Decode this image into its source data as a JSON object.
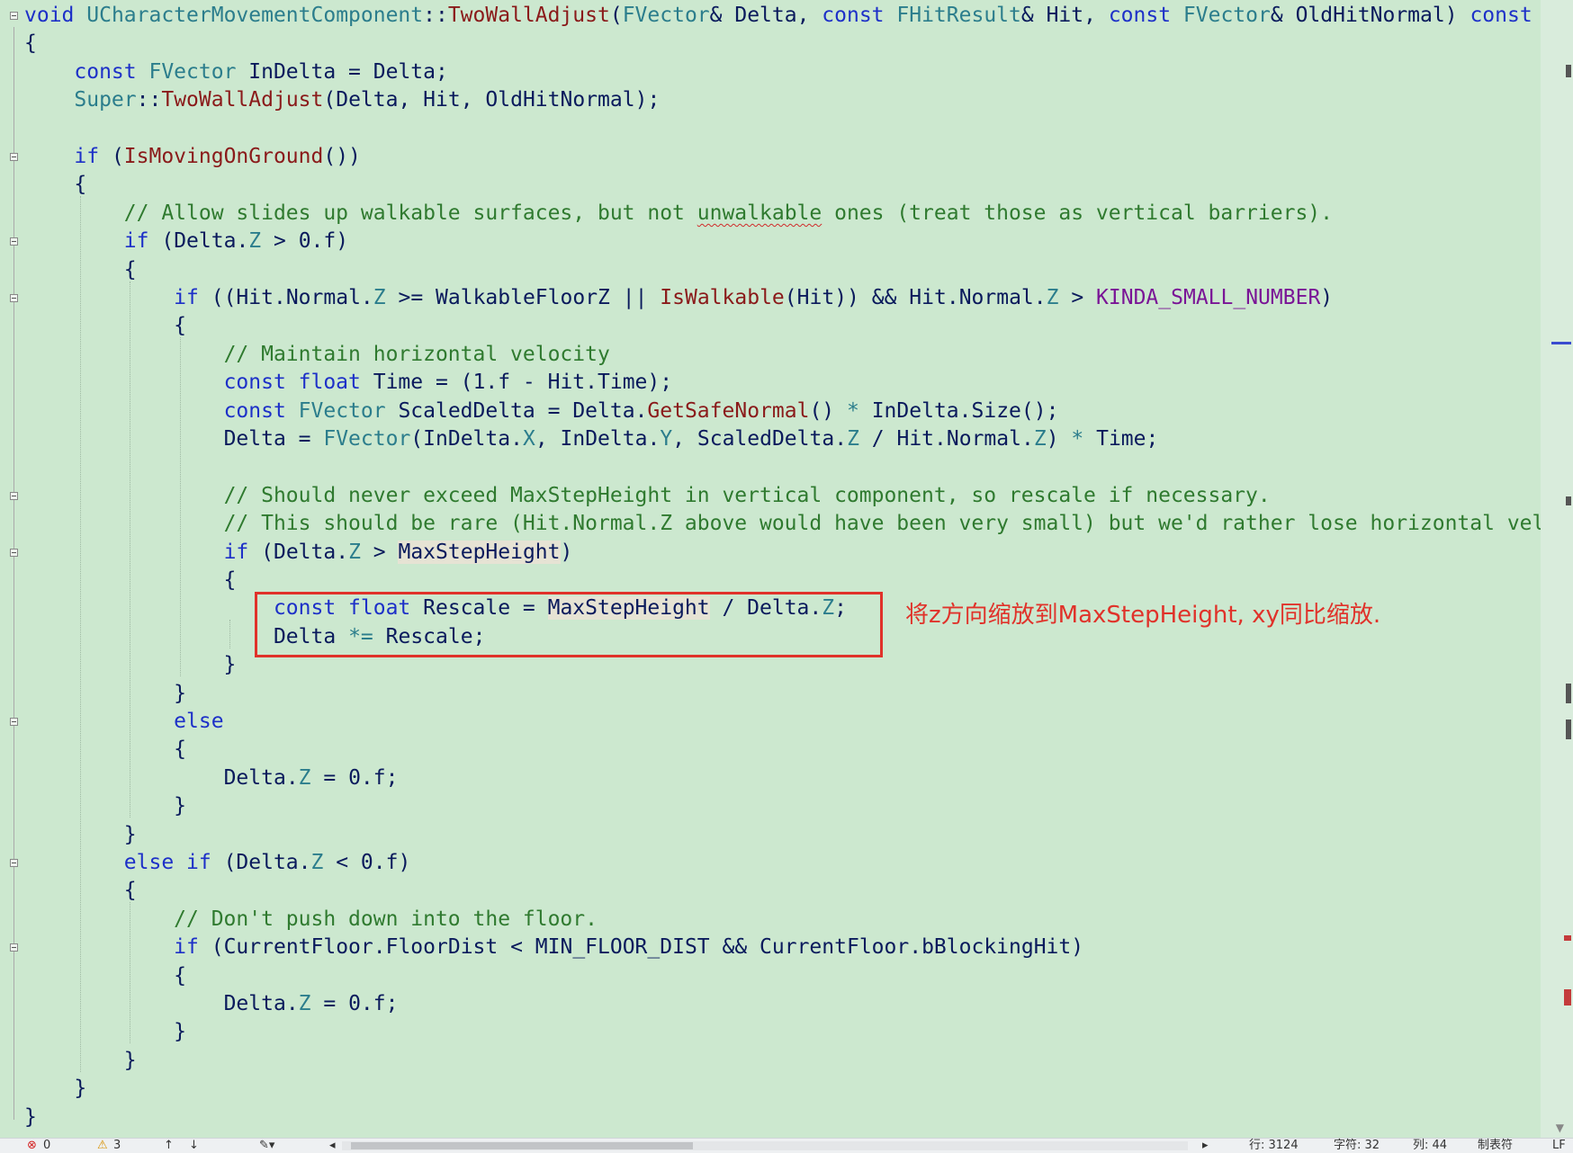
{
  "editor": {
    "lines": [
      [
        [
          "kw",
          "void "
        ],
        [
          "ty",
          "UCharacterMovementComponent"
        ],
        [
          "pu",
          "::"
        ],
        [
          "fn",
          "TwoWallAdjust"
        ],
        [
          "pu",
          "("
        ],
        [
          "ty",
          "FVector"
        ],
        [
          "pu",
          "& "
        ],
        [
          "va",
          "Delta"
        ],
        [
          "pu",
          ", "
        ],
        [
          "kw",
          "const "
        ],
        [
          "ty",
          "FHitResult"
        ],
        [
          "pu",
          "& "
        ],
        [
          "va",
          "Hit"
        ],
        [
          "pu",
          ", "
        ],
        [
          "kw",
          "const "
        ],
        [
          "ty",
          "FVector"
        ],
        [
          "pu",
          "& "
        ],
        [
          "va",
          "OldHitNormal"
        ],
        [
          "pu",
          ") "
        ],
        [
          "kw",
          "const"
        ]
      ],
      [
        [
          "pu",
          "{"
        ]
      ],
      [
        [
          "pu",
          "    "
        ],
        [
          "kw",
          "const "
        ],
        [
          "ty",
          "FVector "
        ],
        [
          "va",
          "InDelta"
        ],
        [
          "pu",
          " = "
        ],
        [
          "va",
          "Delta"
        ],
        [
          "pu",
          ";"
        ]
      ],
      [
        [
          "pu",
          "    "
        ],
        [
          "ty",
          "Super"
        ],
        [
          "pu",
          "::"
        ],
        [
          "fn",
          "TwoWallAdjust"
        ],
        [
          "pu",
          "("
        ],
        [
          "va",
          "Delta"
        ],
        [
          "pu",
          ", "
        ],
        [
          "va",
          "Hit"
        ],
        [
          "pu",
          ", "
        ],
        [
          "va",
          "OldHitNormal"
        ],
        [
          "pu",
          ");"
        ]
      ],
      [],
      [
        [
          "pu",
          "    "
        ],
        [
          "kw",
          "if "
        ],
        [
          "pu",
          "("
        ],
        [
          "fn",
          "IsMovingOnGround"
        ],
        [
          "pu",
          "())"
        ]
      ],
      [
        [
          "pu",
          "    {"
        ]
      ],
      [
        [
          "pu",
          "        "
        ],
        [
          "cm",
          "// Allow slides up walkable surfaces, but not "
        ],
        [
          "cm sq",
          "unwalkable"
        ],
        [
          "cm",
          " ones (treat those as vertical barriers)."
        ]
      ],
      [
        [
          "pu",
          "        "
        ],
        [
          "kw",
          "if "
        ],
        [
          "pu",
          "("
        ],
        [
          "va",
          "Delta"
        ],
        [
          "pu",
          "."
        ],
        [
          "ty",
          "Z"
        ],
        [
          "pu",
          " > 0.f)"
        ]
      ],
      [
        [
          "pu",
          "        {"
        ]
      ],
      [
        [
          "pu",
          "            "
        ],
        [
          "kw",
          "if "
        ],
        [
          "pu",
          "(("
        ],
        [
          "va",
          "Hit"
        ],
        [
          "pu",
          "."
        ],
        [
          "va",
          "Normal"
        ],
        [
          "pu",
          "."
        ],
        [
          "ty",
          "Z"
        ],
        [
          "pu",
          " >= "
        ],
        [
          "va",
          "WalkableFloorZ"
        ],
        [
          "pu",
          " || "
        ],
        [
          "fn",
          "IsWalkable"
        ],
        [
          "pu",
          "("
        ],
        [
          "va",
          "Hit"
        ],
        [
          "pu",
          ")) && "
        ],
        [
          "va",
          "Hit"
        ],
        [
          "pu",
          "."
        ],
        [
          "va",
          "Normal"
        ],
        [
          "pu",
          "."
        ],
        [
          "ty",
          "Z"
        ],
        [
          "pu",
          " > "
        ],
        [
          "mc",
          "KINDA_SMALL_NUMBER"
        ],
        [
          "pu",
          ")"
        ]
      ],
      [
        [
          "pu",
          "            {"
        ]
      ],
      [
        [
          "pu",
          "                "
        ],
        [
          "cm",
          "// Maintain horizontal velocity"
        ]
      ],
      [
        [
          "pu",
          "                "
        ],
        [
          "kw",
          "const float "
        ],
        [
          "va",
          "Time"
        ],
        [
          "pu",
          " = (1.f - "
        ],
        [
          "va",
          "Hit"
        ],
        [
          "pu",
          "."
        ],
        [
          "va",
          "Time"
        ],
        [
          "pu",
          ");"
        ]
      ],
      [
        [
          "pu",
          "                "
        ],
        [
          "kw",
          "const "
        ],
        [
          "ty",
          "FVector "
        ],
        [
          "va",
          "ScaledDelta"
        ],
        [
          "pu",
          " = "
        ],
        [
          "va",
          "Delta"
        ],
        [
          "pu",
          "."
        ],
        [
          "fn",
          "GetSafeNormal"
        ],
        [
          "pu",
          "() "
        ],
        [
          "ty",
          "*"
        ],
        [
          "pu",
          " "
        ],
        [
          "va",
          "InDelta"
        ],
        [
          "pu",
          "."
        ],
        [
          "va",
          "Size"
        ],
        [
          "pu",
          "();"
        ]
      ],
      [
        [
          "pu",
          "                "
        ],
        [
          "va",
          "Delta"
        ],
        [
          "pu",
          " = "
        ],
        [
          "ty",
          "FVector"
        ],
        [
          "pu",
          "("
        ],
        [
          "va",
          "InDelta"
        ],
        [
          "pu",
          "."
        ],
        [
          "ty",
          "X"
        ],
        [
          "pu",
          ", "
        ],
        [
          "va",
          "InDelta"
        ],
        [
          "pu",
          "."
        ],
        [
          "ty",
          "Y"
        ],
        [
          "pu",
          ", "
        ],
        [
          "va",
          "ScaledDelta"
        ],
        [
          "pu",
          "."
        ],
        [
          "ty",
          "Z"
        ],
        [
          "pu",
          " / "
        ],
        [
          "va",
          "Hit"
        ],
        [
          "pu",
          "."
        ],
        [
          "va",
          "Normal"
        ],
        [
          "pu",
          "."
        ],
        [
          "ty",
          "Z"
        ],
        [
          "pu",
          ") "
        ],
        [
          "ty",
          "*"
        ],
        [
          "pu",
          " "
        ],
        [
          "va",
          "Time"
        ],
        [
          "pu",
          ";"
        ]
      ],
      [],
      [
        [
          "pu",
          "                "
        ],
        [
          "cm",
          "// Should never exceed MaxStepHeight in vertical component, so rescale if necessary."
        ]
      ],
      [
        [
          "pu",
          "                "
        ],
        [
          "cm",
          "// This should be rare (Hit.Normal.Z above would have been very small) but we'd rather lose horizontal vel"
        ]
      ],
      [
        [
          "pu",
          "                "
        ],
        [
          "kw",
          "if "
        ],
        [
          "pu",
          "("
        ],
        [
          "va",
          "Delta"
        ],
        [
          "pu",
          "."
        ],
        [
          "ty",
          "Z"
        ],
        [
          "pu",
          " > "
        ],
        [
          "va hl",
          "MaxStepHeight"
        ],
        [
          "pu",
          ")"
        ]
      ],
      [
        [
          "pu",
          "                {"
        ]
      ],
      [
        [
          "pu",
          "                    "
        ],
        [
          "kw",
          "const float "
        ],
        [
          "va",
          "Rescale"
        ],
        [
          "pu",
          " = "
        ],
        [
          "va hl",
          "MaxStepHeight"
        ],
        [
          "pu",
          " / "
        ],
        [
          "va",
          "Delta"
        ],
        [
          "pu",
          "."
        ],
        [
          "ty",
          "Z"
        ],
        [
          "pu",
          ";"
        ]
      ],
      [
        [
          "pu",
          "                    "
        ],
        [
          "va",
          "Delta"
        ],
        [
          "pu",
          " "
        ],
        [
          "ty",
          "*="
        ],
        [
          "pu",
          " "
        ],
        [
          "va",
          "Rescale"
        ],
        [
          "pu",
          ";"
        ]
      ],
      [
        [
          "pu",
          "                }"
        ]
      ],
      [
        [
          "pu",
          "            }"
        ]
      ],
      [
        [
          "pu",
          "            "
        ],
        [
          "kw",
          "else"
        ]
      ],
      [
        [
          "pu",
          "            {"
        ]
      ],
      [
        [
          "pu",
          "                "
        ],
        [
          "va",
          "Delta"
        ],
        [
          "pu",
          "."
        ],
        [
          "ty",
          "Z"
        ],
        [
          "pu",
          " = 0.f;"
        ]
      ],
      [
        [
          "pu",
          "            }"
        ]
      ],
      [
        [
          "pu",
          "        }"
        ]
      ],
      [
        [
          "pu",
          "        "
        ],
        [
          "kw",
          "else if "
        ],
        [
          "pu",
          "("
        ],
        [
          "va",
          "Delta"
        ],
        [
          "pu",
          "."
        ],
        [
          "ty",
          "Z"
        ],
        [
          "pu",
          " < 0.f)"
        ]
      ],
      [
        [
          "pu",
          "        {"
        ]
      ],
      [
        [
          "pu",
          "            "
        ],
        [
          "cm",
          "// Don't push down into the floor."
        ]
      ],
      [
        [
          "pu",
          "            "
        ],
        [
          "kw",
          "if "
        ],
        [
          "pu",
          "("
        ],
        [
          "va",
          "CurrentFloor"
        ],
        [
          "pu",
          "."
        ],
        [
          "va",
          "FloorDist"
        ],
        [
          "pu",
          " < "
        ],
        [
          "va",
          "MIN_FLOOR_DIST"
        ],
        [
          "pu",
          " && "
        ],
        [
          "va",
          "CurrentFloor"
        ],
        [
          "pu",
          "."
        ],
        [
          "va",
          "bBlockingHit"
        ],
        [
          "pu",
          ")"
        ]
      ],
      [
        [
          "pu",
          "            {"
        ]
      ],
      [
        [
          "pu",
          "                "
        ],
        [
          "va",
          "Delta"
        ],
        [
          "pu",
          "."
        ],
        [
          "ty",
          "Z"
        ],
        [
          "pu",
          " = 0.f;"
        ]
      ],
      [
        [
          "pu",
          "            }"
        ]
      ],
      [
        [
          "pu",
          "        }"
        ]
      ],
      [
        [
          "pu",
          "    }"
        ]
      ],
      [
        [
          "pu",
          "}"
        ]
      ]
    ],
    "fold_lines": [
      0,
      5,
      8,
      10,
      17,
      19,
      25,
      30,
      33
    ]
  },
  "annotation": {
    "text": "将z方向缩放到MaxStepHeight, xy同比缩放.",
    "color": "#e0322a"
  },
  "statusbar": {
    "errors": "0",
    "warnings": "3",
    "line": "行: 3124",
    "char": "字符: 32",
    "col": "列: 44",
    "indent": "制表符",
    "eol": "LF"
  },
  "colors": {
    "background": "#cce8cf",
    "keyword": "#1d30c8",
    "type": "#2b7d8c",
    "function": "#8a1a1a",
    "macro": "#7a1596",
    "comment": "#2f7a2f",
    "annotation": "#e0322a"
  }
}
